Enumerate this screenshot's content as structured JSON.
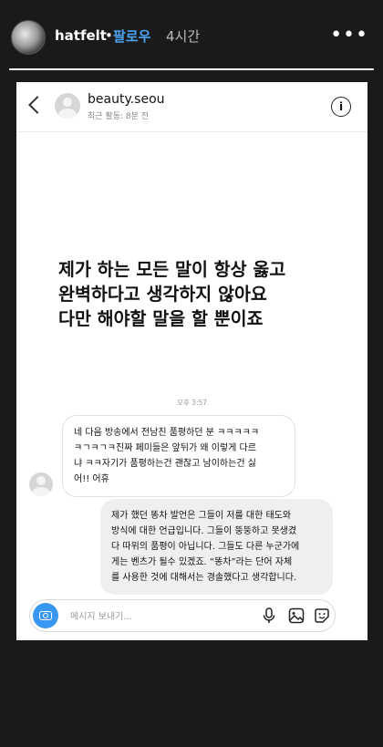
{
  "story": {
    "username": "hatfelt",
    "separator": "•",
    "follow_label": "팔로우",
    "time_ago": "4시간",
    "more_label": "•••",
    "progress": 1.0
  },
  "dm": {
    "contact_name": "beauty.seou",
    "contact_status": "최근 활동: 8분 전",
    "info_label": "i",
    "quote_lines": [
      "제가 하는 모든 말이 항상 옳고",
      "완벽하다고 생각하지 않아요",
      "다만 해야할 말을 할 뿐이죠"
    ],
    "timestamp": "오후 3:57",
    "incoming_message_lines": [
      "네 다음 방송에서 전남친 품평하던 분 ㅋㅋㅋㅋㅋ",
      "ㅋㄱㅋㄱㅋ진짜 페미들은 앞뒤가 왜 이렇게 다르",
      "냐 ㅋㅋ자기가 품평하는건 괜찮고 남이하는건 싫",
      "어!! 어휴"
    ],
    "outgoing_message_lines": [
      "제가 했던 똥차 발언은 그들이 저를 대한 태도와",
      "방식에 대한 언급입니다.  그들이 뚱뚱하고 못생겼",
      "다 따위의 품평이 아닙니다. 그들도 다른 누군가에",
      "게는 벤츠가 될수 있겠죠.  “똥차”라는 단어 자체",
      "를 사용한 것에 대해서는 경솔했다고 생각합니다."
    ],
    "composer_placeholder": "메시지 보내기...",
    "icons": [
      "camera-icon",
      "microphone-icon",
      "image-icon",
      "sticker-icon"
    ],
    "accent_color": "#3897f0"
  }
}
